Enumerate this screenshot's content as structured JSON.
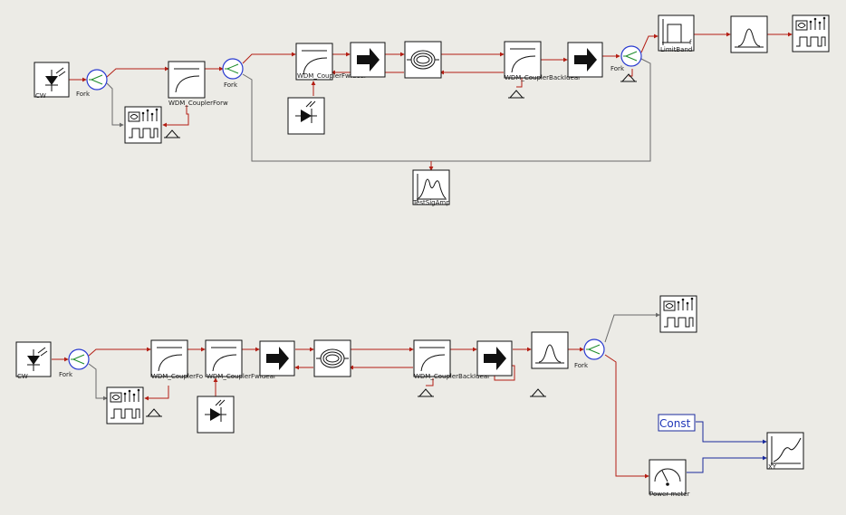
{
  "background": "#ecebe6",
  "colors": {
    "wire_optical": "#b41e14",
    "wire_electrical": "#1a2a9c",
    "wire_neutral": "#6a6a6a",
    "block_fill": "#ffffff",
    "coupler_ring": "#2a3bd0",
    "coupler_center": "#1e8c2a"
  },
  "top_circuit": {
    "laser": {
      "label": "CW",
      "icon": "laser-source-icon"
    },
    "fork_1": {
      "label": "Fork",
      "icon": "fork-icon"
    },
    "spectrum_analyzer": {
      "icon": "spectrum-analyzer-icon"
    },
    "wdm_coupler_forward": {
      "label": "WDM_CouplerForw",
      "icon": "wdm-coupler-icon"
    },
    "fork_2": {
      "label": "Fork",
      "icon": "fork-icon"
    },
    "wdm_coupler_forward_ideal": {
      "label": "WDM_CouplerFwIdeal",
      "icon": "wdm-coupler-icon"
    },
    "pump_laser": {
      "icon": "pump-laser-icon"
    },
    "isolator_1": {
      "icon": "isolator-arrow-icon"
    },
    "fiber": {
      "icon": "fiber-coil-icon"
    },
    "wdm_coupler_backward": {
      "label": "WDM_CouplerBackIdeal",
      "icon": "wdm-coupler-icon"
    },
    "isolator_2": {
      "icon": "isolator-arrow-icon"
    },
    "fork_3": {
      "label": "Fork",
      "icon": "fork-icon"
    },
    "limit_band": {
      "label": "LimitBand",
      "sub": "f",
      "icon": "limit-band-filter-icon"
    },
    "optical_filter": {
      "icon": "optical-filter-icon"
    },
    "spectrum_analyzer_out": {
      "icon": "spectrum-analyzer-icon"
    },
    "test_signal": {
      "label": "TestSigAmp",
      "icon": "test-signal-icon"
    }
  },
  "bottom_circuit": {
    "laser": {
      "label": "CW",
      "icon": "laser-source-icon"
    },
    "fork_1": {
      "label": "Fork",
      "icon": "fork-icon"
    },
    "spectrum_analyzer": {
      "icon": "spectrum-analyzer-icon"
    },
    "wdm_coupler_1": {
      "label": "WDM_CouplerFo",
      "icon": "wdm-coupler-icon"
    },
    "wdm_coupler_2": {
      "label": "WDM_CouplerFwIdeal",
      "icon": "wdm-coupler-icon"
    },
    "pump_laser": {
      "icon": "pump-laser-icon"
    },
    "isolator_1": {
      "icon": "isolator-arrow-icon"
    },
    "fiber": {
      "icon": "fiber-coil-icon"
    },
    "wdm_coupler_backward": {
      "label": "WDM_CouplerBackIdeal",
      "icon": "wdm-coupler-icon"
    },
    "isolator_2": {
      "icon": "isolator-arrow-icon"
    },
    "optical_filter": {
      "icon": "optical-filter-icon"
    },
    "fork_2": {
      "label": "Fork",
      "icon": "fork-icon"
    },
    "spectrum_analyzer_out": {
      "icon": "spectrum-analyzer-icon"
    },
    "const_block": {
      "label": "Const"
    },
    "power_meter": {
      "label": "Power meter",
      "icon": "power-meter-icon"
    },
    "xy_plot": {
      "label": "XY",
      "icon": "xy-plot-icon"
    }
  }
}
